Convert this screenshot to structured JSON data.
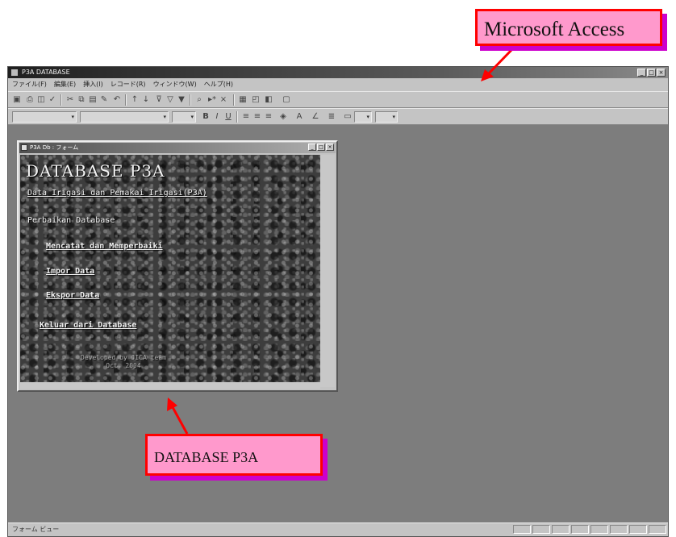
{
  "annotations": {
    "access_label": "Microsoft Access",
    "p3a_label": "DATABASE P3A",
    "arrow_color": "#ff0000",
    "box_fill": "#ff99cc"
  },
  "app": {
    "title": "P3A DATABASE",
    "menu": [
      "ファイル(F)",
      "編集(E)",
      "挿入(I)",
      "レコード(R)",
      "ウィンドウ(W)",
      "ヘルプ(H)"
    ],
    "status_text": "フォーム ビュー"
  },
  "form_window": {
    "title": "P3A Db : フォーム",
    "heading": "DATABASE P3A",
    "subtitle": "Data Irigasi dan Pemakai Irigasi(P3A)",
    "section": "Perbaikan Database",
    "links": [
      "Mencatat dan Memperbaiki",
      "Impor Data",
      "Ekspor Data",
      "Keluar dari Database"
    ],
    "credit_line1": "Developed by JICA team",
    "credit_line2": "Oct. 2004"
  }
}
